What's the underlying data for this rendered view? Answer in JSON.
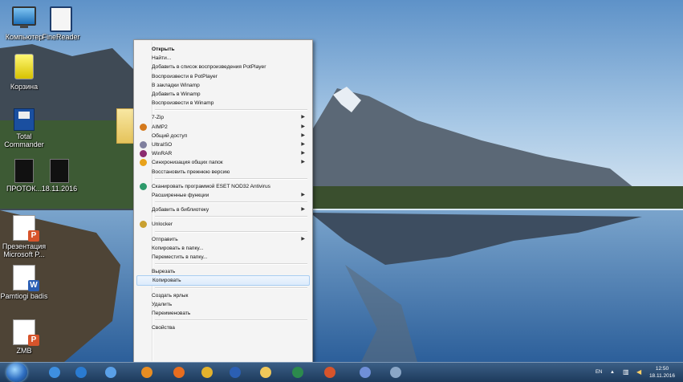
{
  "desktop": {
    "icons": [
      {
        "label": "Компьютер",
        "icon": "computer-icon"
      },
      {
        "label": "FineReader",
        "icon": "book-icon"
      },
      {
        "label": "Корзина",
        "icon": "recycle-bin-icon"
      },
      {
        "label": "Total Commander",
        "icon": "floppy-icon"
      },
      {
        "label": "ПРОТОК...",
        "icon": "dark-file-icon"
      },
      {
        "label": "18.11.2016",
        "icon": "dark-file-icon"
      },
      {
        "label": "Презентация Microsoft P...",
        "icon": "powerpoint-icon"
      },
      {
        "label": "Pamtiogi badis",
        "icon": "word-icon"
      },
      {
        "label": "ZMB",
        "icon": "powerpoint-icon"
      }
    ]
  },
  "context_menu": {
    "items": [
      {
        "label": "Открыть",
        "bold": true
      },
      {
        "label": "Найти..."
      },
      {
        "label": "Добавить в список воспроизведения PotPlayer"
      },
      {
        "label": "Воспроизвести в PotPlayer"
      },
      {
        "label": "В закладки Winamp"
      },
      {
        "label": "Добавить в Winamp"
      },
      {
        "label": "Воспроизвести в Winamp"
      },
      {
        "label": "7-Zip",
        "submenu": true
      },
      {
        "label": "AIMP2",
        "submenu": true,
        "icon": "aimp-icon",
        "icon_color": "#d4791c"
      },
      {
        "label": "Общий доступ",
        "submenu": true
      },
      {
        "label": "UltraISO",
        "submenu": true,
        "icon": "ultraiso-icon",
        "icon_color": "#7f7f9e"
      },
      {
        "label": "WinRAR",
        "submenu": true,
        "icon": "winrar-icon",
        "icon_color": "#8b2a6e"
      },
      {
        "label": "Синхронизация общих папок",
        "submenu": true,
        "icon": "sync-icon",
        "icon_color": "#e8a21a"
      },
      {
        "label": "Восстановить прежнюю версию"
      },
      {
        "label": "Сканировать программой ESET NOD32 Antivirus",
        "icon": "eset-icon",
        "icon_color": "#2d9a6b"
      },
      {
        "label": "Расширенные функции",
        "submenu": true
      },
      {
        "label": "Добавить в библиотеку",
        "submenu": true
      },
      {
        "label": "Unlocker",
        "icon": "unlocker-icon",
        "icon_color": "#c9a030"
      },
      {
        "label": "Отправить",
        "submenu": true
      },
      {
        "label": "Копировать в папку..."
      },
      {
        "label": "Переместить в папку..."
      },
      {
        "label": "Вырезать"
      },
      {
        "label": "Копировать",
        "highlighted": true
      },
      {
        "label": "Создать ярлык"
      },
      {
        "label": "Удалить"
      },
      {
        "label": "Переименовать"
      },
      {
        "label": "Свойства"
      }
    ]
  },
  "taskbar": {
    "apps": [
      {
        "name": "internet-explorer-icon",
        "color": "#3e8fe0"
      },
      {
        "name": "media-player-icon",
        "color": "#2a7bd1"
      },
      {
        "name": "browser-icon",
        "color": "#5aa0e8"
      },
      {
        "name": "aimp-icon",
        "color": "#e88d22"
      },
      {
        "name": "firefox-icon",
        "color": "#e86d1f"
      },
      {
        "name": "chrome-icon",
        "color": "#e3b22d"
      },
      {
        "name": "word-icon",
        "color": "#2b5fb4"
      },
      {
        "name": "explorer-icon",
        "color": "#f0c85a"
      },
      {
        "name": "excel-icon",
        "color": "#2c8a4d"
      },
      {
        "name": "powerpoint-icon",
        "color": "#d7542b"
      },
      {
        "name": "paint-icon",
        "color": "#6f8fd8"
      },
      {
        "name": "tool-icon",
        "color": "#8aa6c6"
      }
    ],
    "language": "EN",
    "time": "12:50",
    "date": "18.11.2016"
  },
  "colors": {
    "sky": "#6f9fce",
    "menu_bg": "#f4f4f4",
    "highlight": "#dcebfc"
  }
}
